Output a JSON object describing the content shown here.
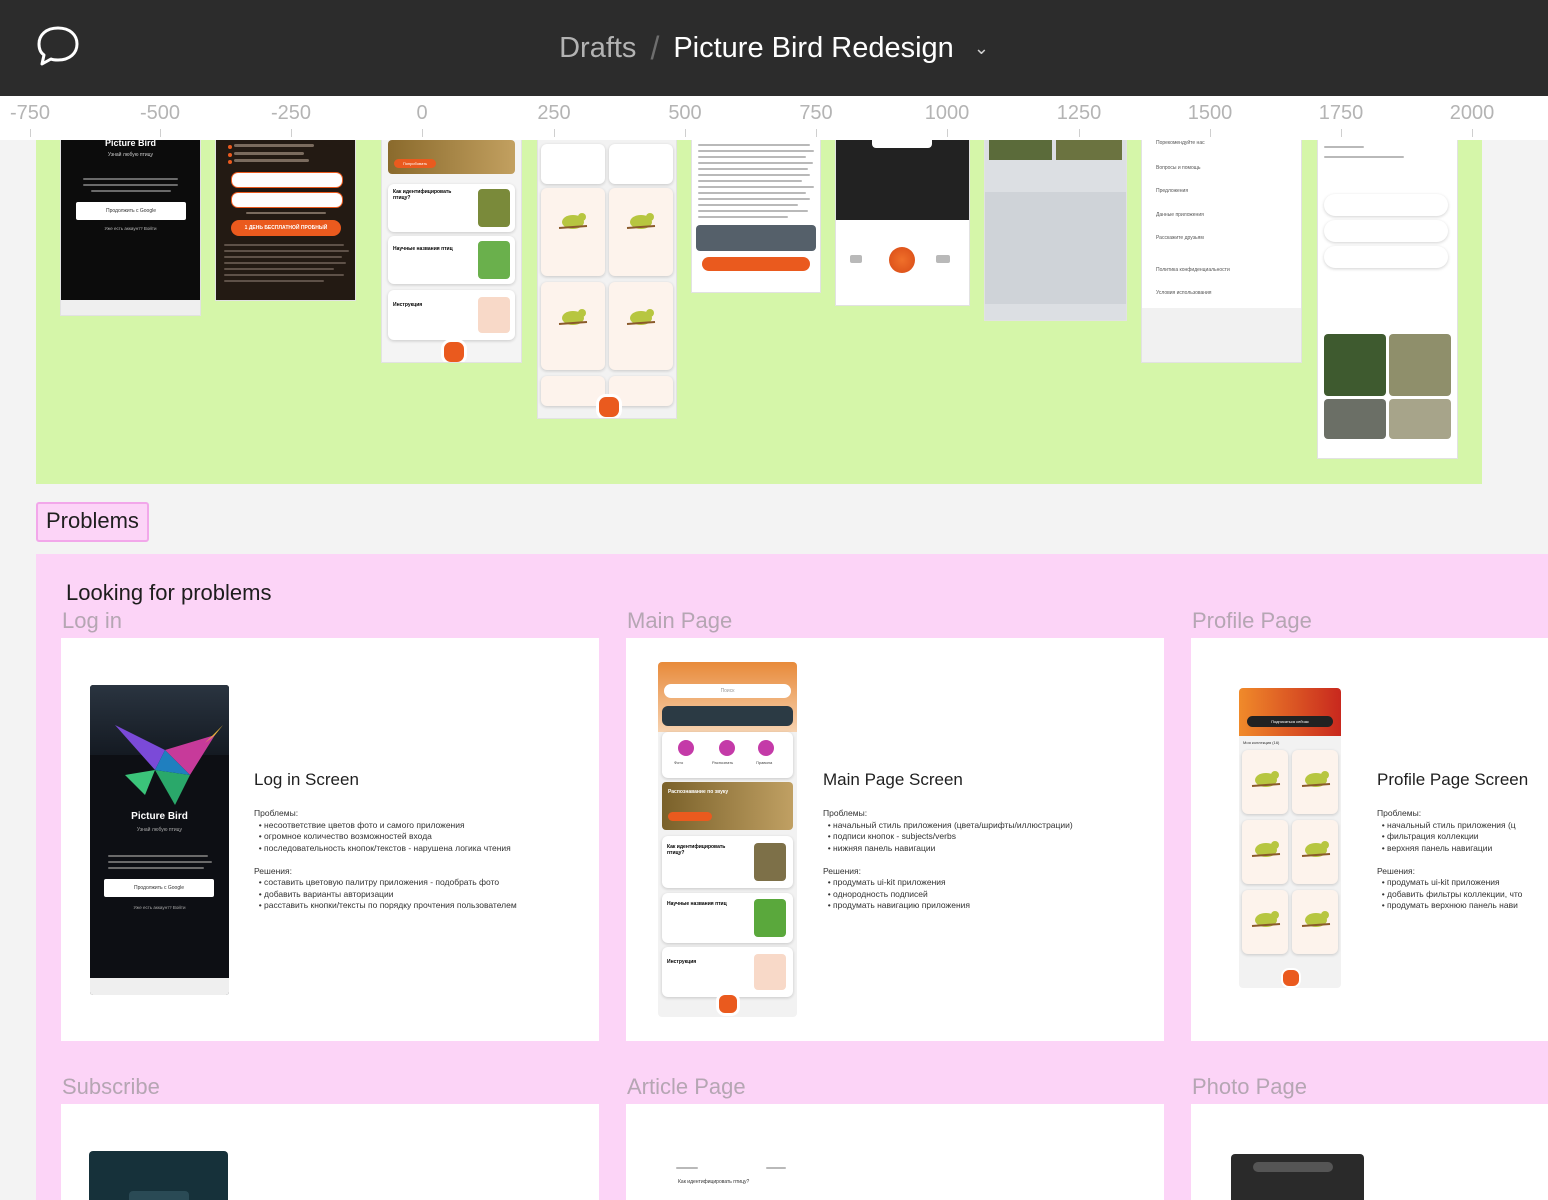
{
  "header": {
    "breadcrumb_root": "Drafts",
    "separator": "/",
    "file_title": "Picture Bird Redesign",
    "icons": {
      "comment": "comment-icon",
      "dropdown": "chevron-down-icon"
    }
  },
  "ruler": {
    "ticks": [
      "-750",
      "-500",
      "-250",
      "0",
      "250",
      "500",
      "750",
      "1000",
      "1250",
      "1500",
      "1750",
      "2000"
    ]
  },
  "colors": {
    "green_frame": "#d5f6a9",
    "pink_frame": "#fcd4f7",
    "accent_orange": "#ea5a1e",
    "topbar": "#2c2c2c"
  },
  "top_screens": {
    "login": {
      "app_name": "Picture Bird",
      "tagline": "Узнай любую птицу",
      "google_button": "Продолжить с Google",
      "link": "Уже есть аккаунт? Войти"
    },
    "subscribe": {
      "cta": "1 ДЕНЬ БЕСПЛАТНОЙ ПРОБНЫЙ"
    },
    "main": {
      "card1": "Как идентифицировать птицу?",
      "card2": "Научные названия птиц",
      "card3": "Инструкция",
      "badge": "Попробовать"
    },
    "settings": {
      "items": [
        "Порекомендуйте нас",
        "Вопросы и помощь",
        "Предложения",
        "Данные приложения",
        "Расскажите друзьям",
        "Политика конфиденциальности",
        "Условия использования"
      ]
    }
  },
  "problems_frame": {
    "label": "Problems",
    "title": "Looking for problems",
    "sections": [
      {
        "label": "Log in",
        "screen_title": "Log in Screen",
        "notes": "Проблемы:\n  • несоответствие цветов фото и самого приложения\n  • огромное количество возможностей входа\n  • последовательность кнопок/текстов - нарушена логика чтения\n\nРешения:\n  • составить цветовую палитру приложения - подобрать фото\n  • добавить варианты авторизации\n  • расставить кнопки/тексты по порядку прочтения пользователем",
        "app_name": "Picture Bird",
        "tagline": "Узнай любую птицу",
        "google_button": "Продолжить с Google",
        "link": "Уже есть аккаунт? Войти"
      },
      {
        "label": "Main Page",
        "screen_title": "Main Page Screen",
        "notes": "Проблемы:\n  • начальный стиль приложения (цвета/шрифты/иллюстрации)\n  • подписи кнопок - subjects/verbs\n  • нижняя панель навигации\n\nРешения:\n  • продумать ui-kit приложения\n  • однородность подписей\n  • продумать навигацию приложения",
        "search": "Поиск",
        "banner": "Распознавание по звуку",
        "card1": "Как идентифицировать птицу?",
        "card2": "Научные названия птиц",
        "card3": "Инструкция",
        "buttons": [
          "Фото",
          "Распознать",
          "Правила"
        ]
      },
      {
        "label": "Profile Page",
        "screen_title": "Profile Page Screen",
        "notes": "Проблемы:\n  • начальный стиль приложения (ц\n  • фильтрация коллекции\n  • верхняя панель навигации\n\nРешения:\n  • продумать ui-kit приложения\n  • добавить фильтры коллекции, что\n  • продумать верхнюю панель нави",
        "header_button": "Подписаться сейчас",
        "collection": "Моя коллекция (16)"
      },
      {
        "label": "Subscribe"
      },
      {
        "label": "Article Page",
        "mini_title": "Как идентифицировать птицу?"
      },
      {
        "label": "Photo Page"
      }
    ]
  }
}
